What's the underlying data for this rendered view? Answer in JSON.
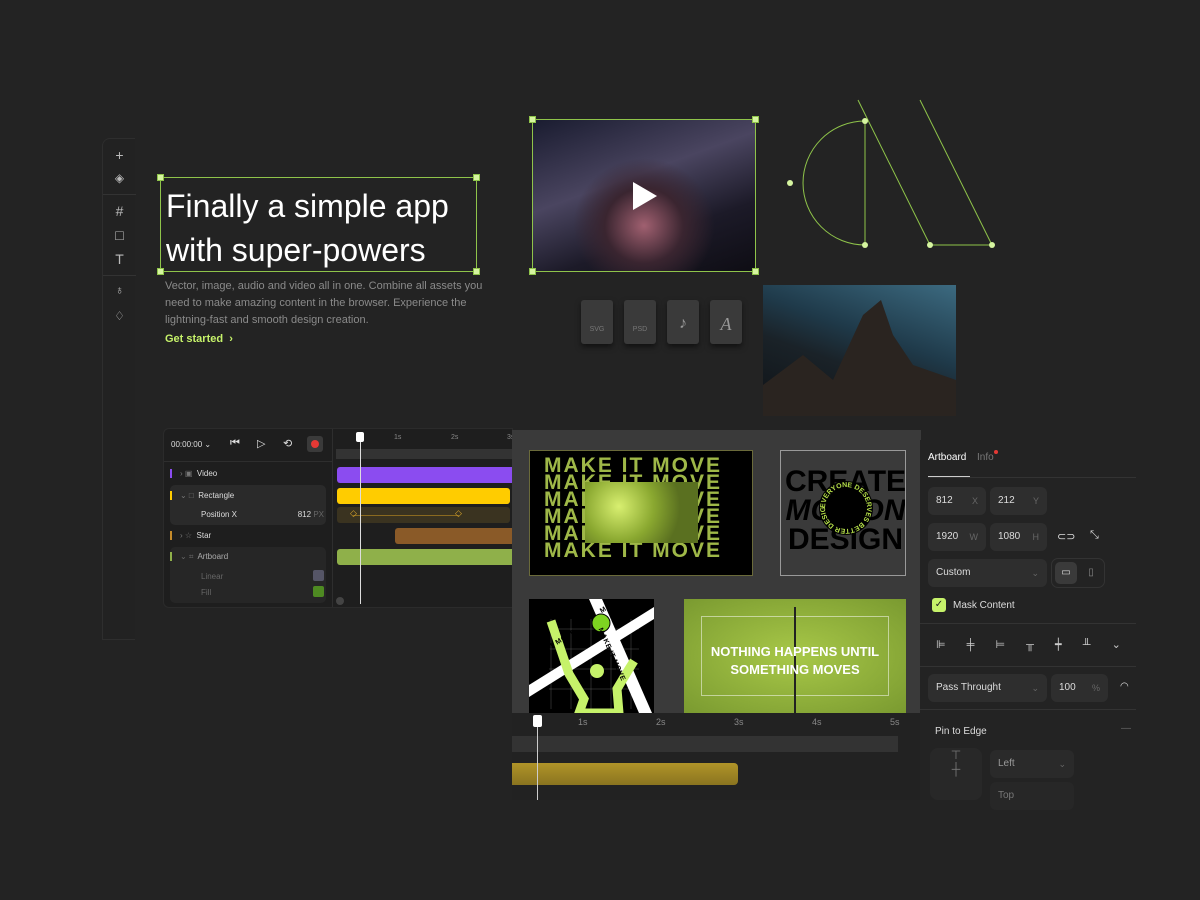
{
  "toolbar": {
    "icons": [
      "plus-icon",
      "layers-icon",
      "frame-icon",
      "rectangle-icon",
      "text-icon",
      "pen-icon",
      "pencil-icon"
    ]
  },
  "hero": {
    "title_line1": "Finally a simple app",
    "title_line2": "with super-powers",
    "description": "Vector, image, audio and video all in one. Combine all assets you need to make amazing content in the browser. Experience the lightning-fast and smooth design creation.",
    "cta": "Get started"
  },
  "file_types": [
    "SVG",
    "PSD",
    "♪",
    "A"
  ],
  "timeline": {
    "time": "00:00:00",
    "ticks": [
      "1s",
      "2s",
      "3s"
    ],
    "layers": [
      {
        "name": "Video",
        "color": "#8b4cf0"
      },
      {
        "name": "Rectangle",
        "color": "#ffcc00"
      },
      {
        "name": "Position X",
        "value": "812",
        "unit": "PX"
      },
      {
        "name": "Star",
        "color": "#8a5a28"
      },
      {
        "name": "Artboard",
        "color": "#8fb04a"
      },
      {
        "name": "Linear"
      },
      {
        "name": "Fill"
      }
    ]
  },
  "canvas": {
    "art1_text": "MAKE IT MOVE",
    "art2_line1": "CREATE",
    "art2_line2": "MOTION",
    "art2_line3": "DESIGN",
    "art2_ring": "EVERYONE DESERVES BETTER DESIGN",
    "art3_text": "MAKE IT MOVE",
    "art4_line1": "NOTHING HAPPENS UNTIL",
    "art4_line2": "SOMETHING MOVES"
  },
  "bottom_timeline": {
    "ticks": [
      "1s",
      "2s",
      "3s",
      "4s",
      "5s"
    ]
  },
  "panel": {
    "tab_artboard": "Artboard",
    "tab_info": "Info",
    "x": "812",
    "x_unit": "X",
    "y": "212",
    "y_unit": "Y",
    "w": "1920",
    "w_unit": "W",
    "h": "1080",
    "h_unit": "H",
    "preset": "Custom",
    "mask_content": "Mask Content",
    "mask_checked": true,
    "blend": "Pass Throught",
    "opacity": "100",
    "opacity_unit": "%",
    "pin_to_edge": "Pin to Edge",
    "pin_h": "Left",
    "pin_v": "Top"
  },
  "colors": {
    "accent": "#c6f26a",
    "background": "#232323",
    "selection": "#8fc44a",
    "record": "#e53935"
  }
}
